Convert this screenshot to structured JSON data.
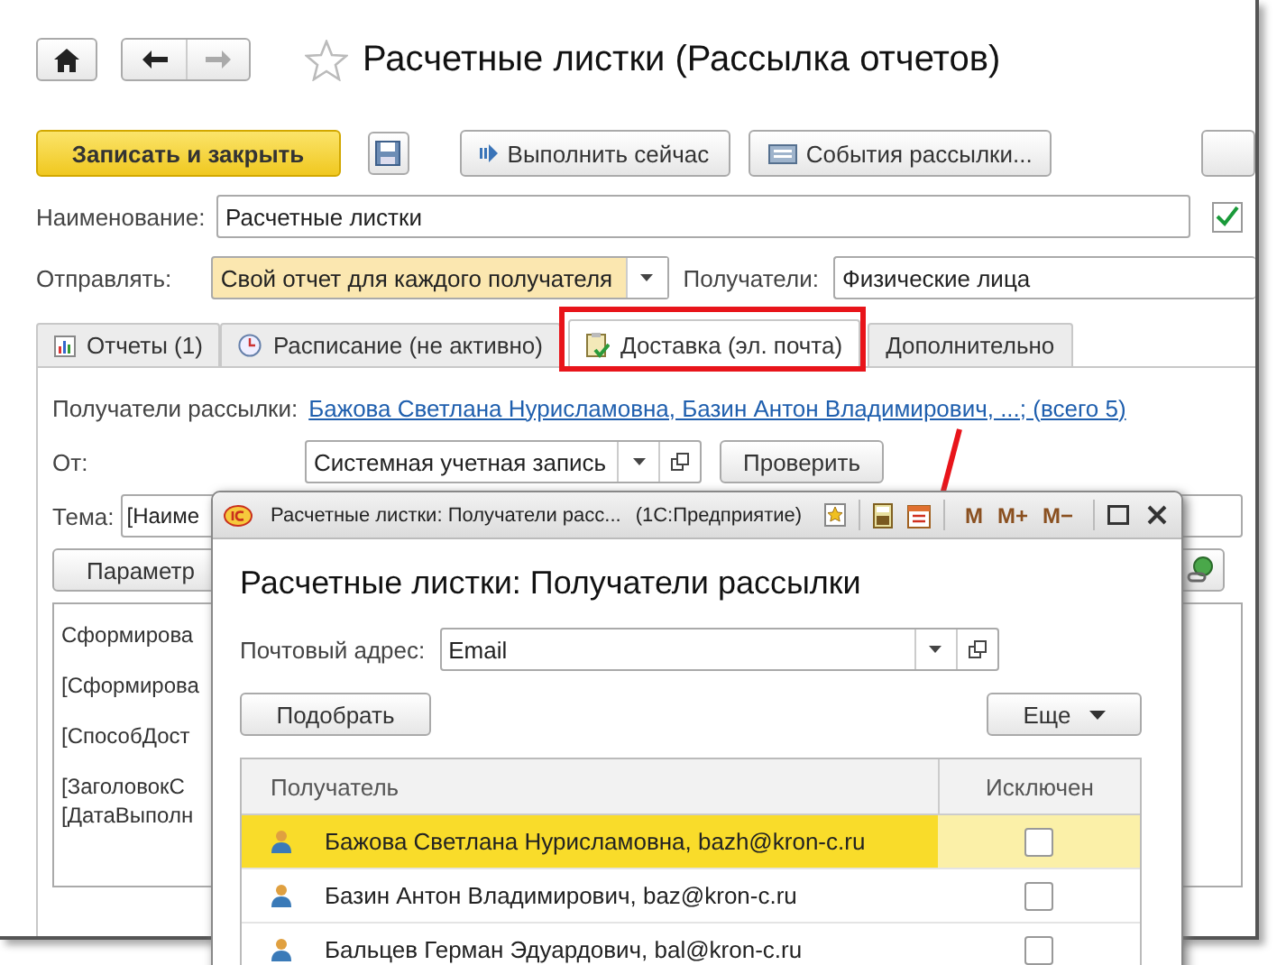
{
  "nav": {
    "title": "Расчетные листки (Рассылка отчетов)"
  },
  "toolbar": [
    {
      "kind": "primary",
      "label": "Записать и закрыть"
    },
    {
      "kind": "save"
    },
    {
      "kind": "run",
      "label": "Выполнить сейчас"
    },
    {
      "kind": "events",
      "label": "События рассылки..."
    },
    {
      "kind": "cut"
    }
  ],
  "name_row": {
    "label": "Наименование:",
    "value": "Расчетные листки",
    "checked": true
  },
  "send_row": {
    "label": "Отправлять:",
    "value": "Свой отчет для каждого получателя",
    "recipients_label": "Получатели:",
    "recipients_value": "Физические лица"
  },
  "tabs": [
    {
      "kind": "report",
      "label": "Отчеты (1)",
      "selected": false
    },
    {
      "kind": "schedule",
      "label": "Расписание (не активно)",
      "selected": false
    },
    {
      "kind": "delivery",
      "label": "Доставка (эл. почта)",
      "selected": true
    },
    {
      "kind": "plain",
      "label": "Дополнительно",
      "selected": false
    }
  ],
  "delivery": {
    "recipients_label": "Получатели рассылки:",
    "recipients_link": "Бажова Светлана Нурисламовна, Базин Антон Владимирович, ...; (всего 5)",
    "from_label": "От:",
    "from_value": "Системная учетная запись",
    "check_button": "Проверить",
    "subject_label": "Тема:",
    "subject_value": "[Наиме",
    "param_button": "Параметр",
    "body_lines": [
      "Сформирова",
      "[Сформирова",
      "[СпособДост",
      "[ЗаголовокС",
      "[ДатаВыполн"
    ]
  },
  "dialog": {
    "title": "Расчетные листки: Получатели расс...",
    "app": "(1С:Предприятие)",
    "memory_buttons": [
      "M",
      "M+",
      "M−"
    ],
    "heading": "Расчетные листки: Получатели рассылки",
    "address_label": "Почтовый адрес:",
    "address_value": "Email",
    "pick_button": "Подобрать",
    "more_button": "Еще",
    "columns": [
      "Получатель",
      "Исключен"
    ],
    "rows": [
      {
        "recipient": "Бажова Светлана Нурисламовна, bazh@kron-c.ru",
        "excluded": false,
        "selected": true
      },
      {
        "recipient": "Базин Антон Владимирович, baz@kron-c.ru",
        "excluded": false,
        "selected": false
      },
      {
        "recipient": "Бальцев Герман Эдуардович, bal@kron-c.ru",
        "excluded": false,
        "selected": false
      }
    ]
  }
}
